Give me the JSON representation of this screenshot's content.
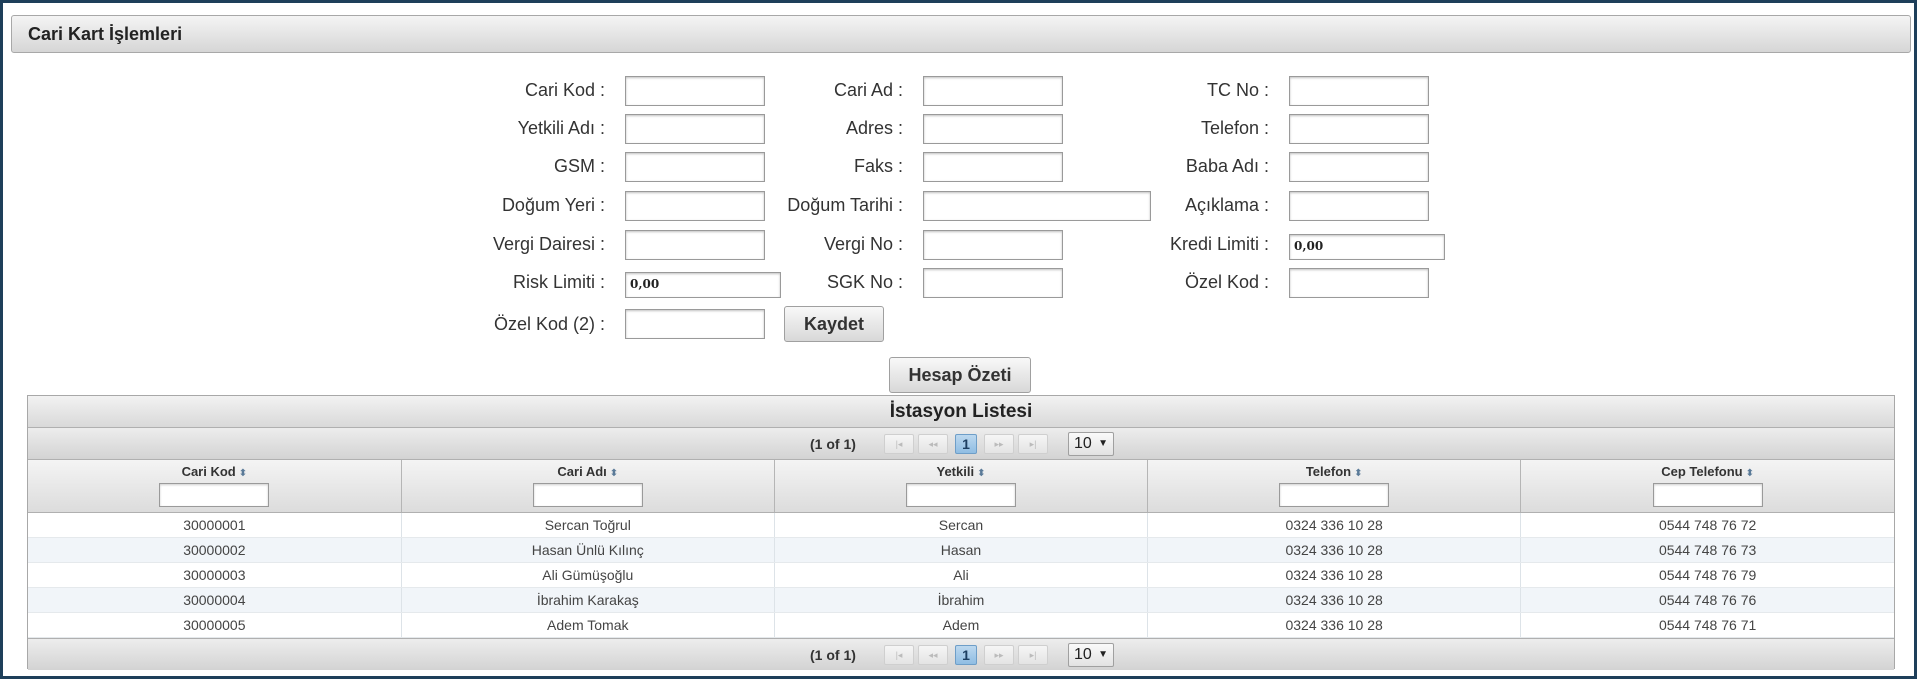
{
  "panel": {
    "title": "Cari Kart İşlemleri"
  },
  "form": {
    "cari_kod": {
      "label": "Cari Kod :",
      "value": ""
    },
    "cari_ad": {
      "label": "Cari Ad :",
      "value": ""
    },
    "tc_no": {
      "label": "TC No :",
      "value": ""
    },
    "yetkili_adi": {
      "label": "Yetkili Adı :",
      "value": ""
    },
    "adres": {
      "label": "Adres :",
      "value": ""
    },
    "telefon": {
      "label": "Telefon :",
      "value": ""
    },
    "gsm": {
      "label": "GSM :",
      "value": ""
    },
    "faks": {
      "label": "Faks :",
      "value": ""
    },
    "baba_adi": {
      "label": "Baba Adı :",
      "value": ""
    },
    "dogum_yeri": {
      "label": "Doğum Yeri :",
      "value": ""
    },
    "dogum_tarihi": {
      "label": "Doğum Tarihi :",
      "value": ""
    },
    "aciklama": {
      "label": "Açıklama :",
      "value": ""
    },
    "vergi_dairesi": {
      "label": "Vergi Dairesi :",
      "value": ""
    },
    "vergi_no": {
      "label": "Vergi No :",
      "value": ""
    },
    "kredi_limiti": {
      "label": "Kredi Limiti :",
      "value": "0,00"
    },
    "risk_limiti": {
      "label": "Risk Limiti :",
      "value": "0,00"
    },
    "sgk_no": {
      "label": "SGK No :",
      "value": ""
    },
    "ozel_kod": {
      "label": "Özel Kod :",
      "value": ""
    },
    "ozel_kod_2": {
      "label": "Özel Kod (2) :",
      "value": ""
    },
    "save_label": "Kaydet",
    "summary_label": "Hesap Özeti"
  },
  "grid": {
    "title": "İstasyon Listesi",
    "paginator": {
      "current": "(1 of 1)",
      "first": "|◂",
      "prev": "◂◂",
      "page": "1",
      "next": "▸▸",
      "last": "▸|",
      "rows_per_page": "10",
      "dropdown_arrow": "▼"
    },
    "sort_glyph": "⬍",
    "columns": [
      "Cari Kod",
      "Cari Adı",
      "Yetkili",
      "Telefon",
      "Cep Telefonu"
    ],
    "rows": [
      [
        "30000001",
        "Sercan Toğrul",
        "Sercan",
        "0324 336 10 28",
        "0544 748 76 72"
      ],
      [
        "30000002",
        "Hasan Ünlü Kılınç",
        "Hasan",
        "0324 336 10 28",
        "0544 748 76 73"
      ],
      [
        "30000003",
        "Ali Gümüşoğlu",
        "Ali",
        "0324 336 10 28",
        "0544 748 76 79"
      ],
      [
        "30000004",
        "İbrahim Karakaş",
        "İbrahim",
        "0324 336 10 28",
        "0544 748 76 76"
      ],
      [
        "30000005",
        "Adem Tomak",
        "Adem",
        "0324 336 10 28",
        "0544 748 76 71"
      ]
    ]
  }
}
